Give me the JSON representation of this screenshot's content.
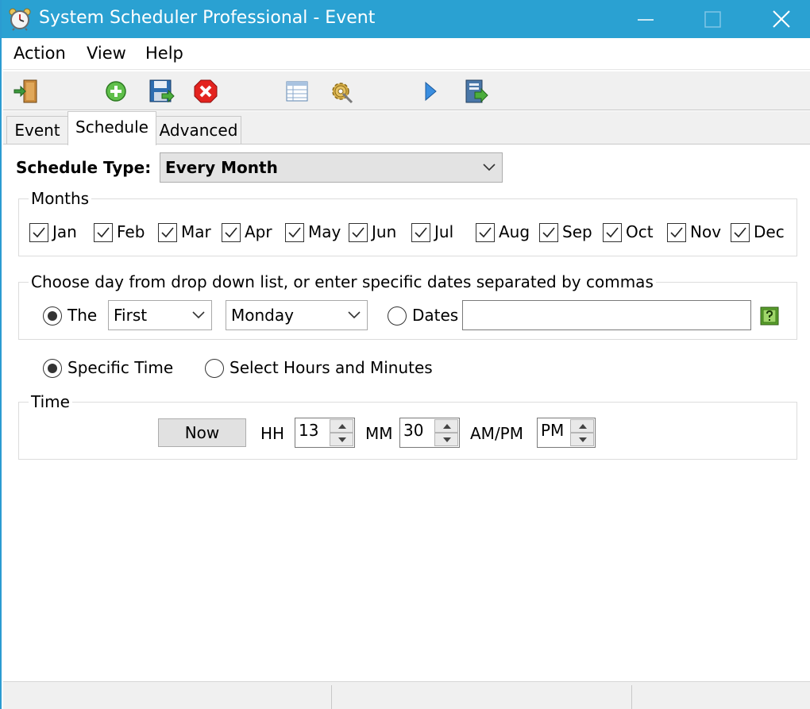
{
  "window": {
    "title": "System Scheduler Professional - Event",
    "accent_color": "#2aa1d2"
  },
  "menu": {
    "items": [
      "Action",
      "View",
      "Help"
    ]
  },
  "toolbar": {
    "buttons": [
      "exit-door-icon",
      "add-icon",
      "save-icon",
      "delete-icon",
      "list-icon",
      "settings-gear-icon",
      "run-play-icon",
      "export-icon"
    ]
  },
  "tabs": {
    "items": [
      "Event",
      "Schedule",
      "Advanced"
    ],
    "active": "Schedule"
  },
  "schedule": {
    "type_label": "Schedule Type:",
    "type_value": "Every Month"
  },
  "months": {
    "title": "Months",
    "items": [
      {
        "label": "Jan",
        "checked": true
      },
      {
        "label": "Feb",
        "checked": true
      },
      {
        "label": "Mar",
        "checked": true
      },
      {
        "label": "Apr",
        "checked": true
      },
      {
        "label": "May",
        "checked": true
      },
      {
        "label": "Jun",
        "checked": true
      },
      {
        "label": "Jul",
        "checked": true
      },
      {
        "label": "Aug",
        "checked": true
      },
      {
        "label": "Sep",
        "checked": true
      },
      {
        "label": "Oct",
        "checked": true
      },
      {
        "label": "Nov",
        "checked": true
      },
      {
        "label": "Dec",
        "checked": true
      }
    ]
  },
  "day": {
    "title": "Choose day from drop down list, or enter specific dates separated by commas",
    "the_label": "The",
    "the_selected": true,
    "ordinal_value": "First",
    "weekday_value": "Monday",
    "dates_label": "Dates",
    "dates_selected": false,
    "dates_value": ""
  },
  "time_mode": {
    "specific_label": "Specific Time",
    "specific_selected": true,
    "hours_minutes_label": "Select Hours and Minutes",
    "hours_minutes_selected": false
  },
  "time": {
    "title": "Time",
    "now_label": "Now",
    "hh_label": "HH",
    "hh_value": "13",
    "mm_label": "MM",
    "mm_value": "30",
    "ampm_label": "AM/PM",
    "ampm_value": "PM"
  }
}
